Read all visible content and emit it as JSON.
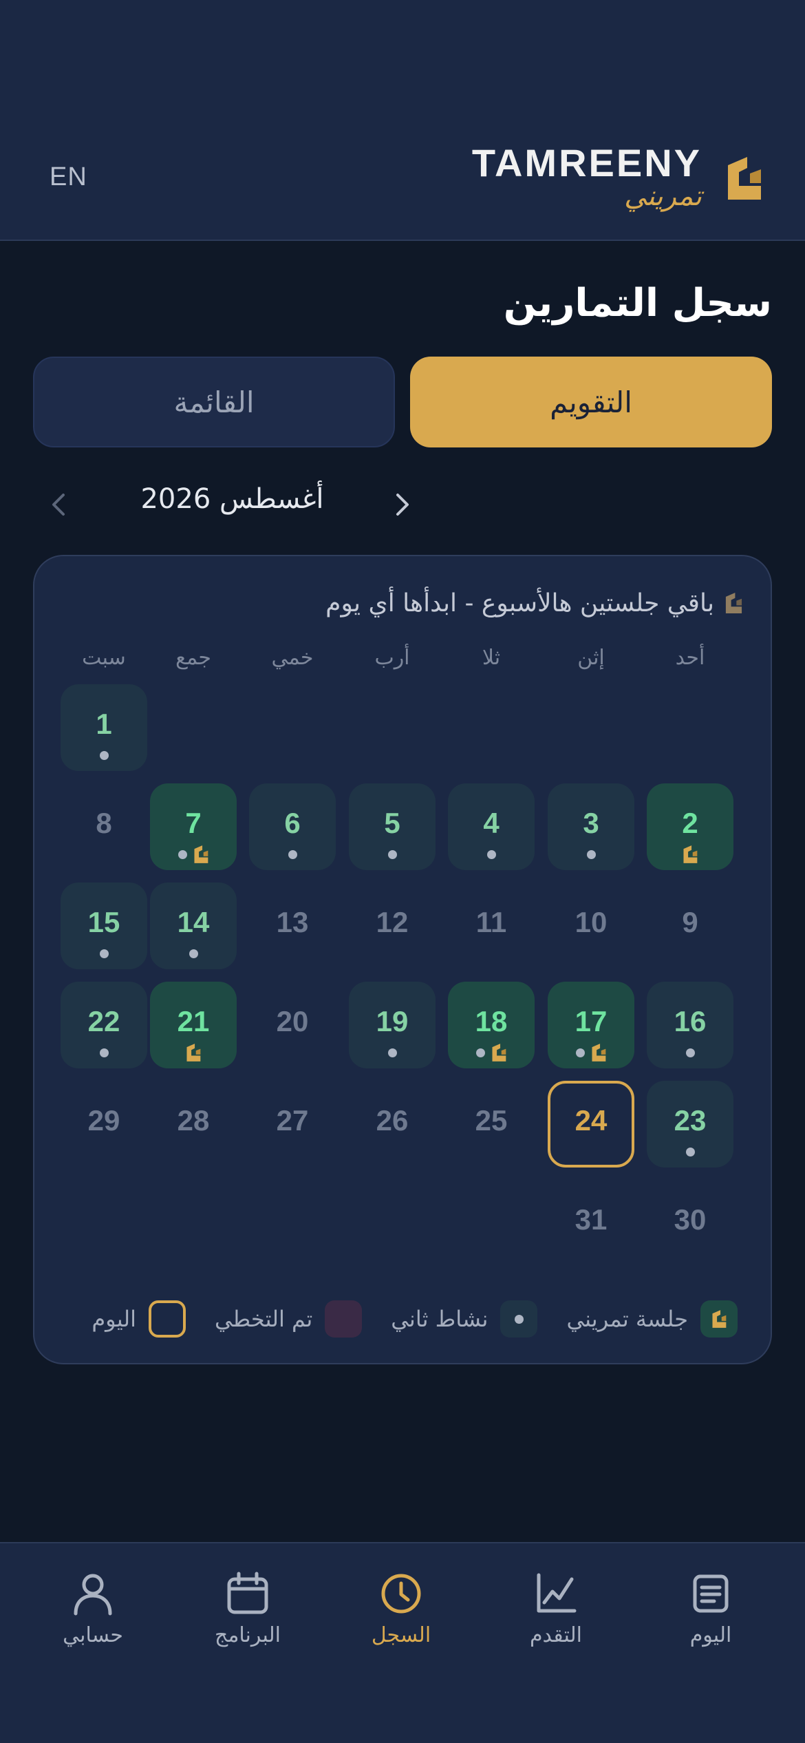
{
  "header": {
    "lang_toggle": "EN",
    "brand_en": "TAMREENY",
    "brand_ar": "تمريني"
  },
  "page": {
    "title": "سجل التمارين"
  },
  "tabs": [
    {
      "label": "التقويم",
      "active": true
    },
    {
      "label": "القائمة",
      "active": false
    }
  ],
  "month_nav": {
    "label": "أغسطس 2026"
  },
  "calendar": {
    "banner": "باقي جلستين هالأسبوع - ابدأها أي يوم",
    "weekdays": [
      "أحد",
      "إثن",
      "ثلا",
      "أرب",
      "خمي",
      "جمع",
      "سبت"
    ],
    "days": {
      "d1": "1",
      "d2": "2",
      "d3": "3",
      "d4": "4",
      "d5": "5",
      "d6": "6",
      "d7": "7",
      "d8": "8",
      "d9": "9",
      "d10": "10",
      "d11": "11",
      "d12": "12",
      "d13": "13",
      "d14": "14",
      "d15": "15",
      "d16": "16",
      "d17": "17",
      "d18": "18",
      "d19": "19",
      "d20": "20",
      "d21": "21",
      "d22": "22",
      "d23": "23",
      "d24": "24",
      "d25": "25",
      "d26": "26",
      "d27": "27",
      "d28": "28",
      "d29": "29",
      "d30": "30",
      "d31": "31"
    },
    "workout_days": [
      2,
      7,
      17,
      18,
      21
    ],
    "activity_days": [
      1,
      3,
      4,
      5,
      6,
      7,
      14,
      15,
      16,
      17,
      18,
      19,
      22,
      23
    ],
    "today": 24
  },
  "legend": {
    "workout": "جلسة تمريني",
    "activity": "نشاط ثاني",
    "skipped": "تم التخطي",
    "today": "اليوم"
  },
  "bottom_nav": {
    "today": "اليوم",
    "progress": "التقدم",
    "log": "السجل",
    "program": "البرنامج",
    "account": "حسابي"
  },
  "colors": {
    "accent": "#d9a94f",
    "header_bg": "#1b2844",
    "page_bg": "#0f1827",
    "workout_day": "#1e4a44",
    "activity_day": "#1f3446",
    "skipped": "#3a2a46"
  }
}
